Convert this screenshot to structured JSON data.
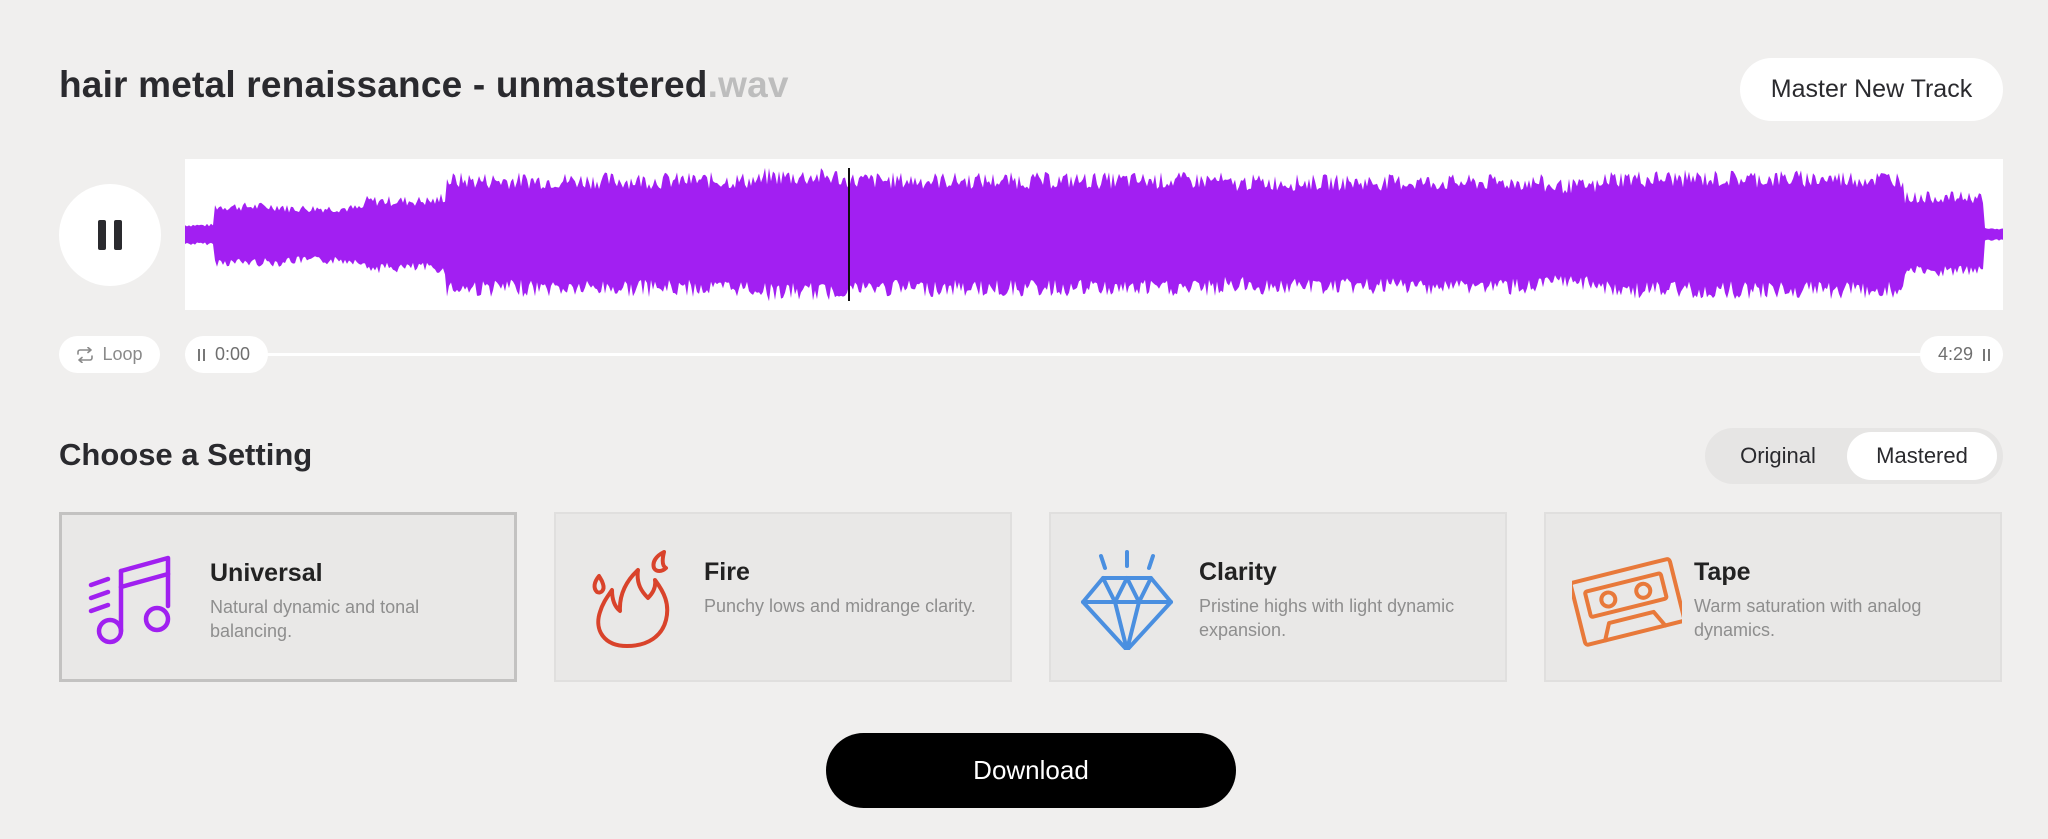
{
  "header": {
    "track_name": "hair metal renaissance - unmastered",
    "track_ext": ".wav",
    "master_button_label": "Master New Track"
  },
  "player": {
    "state": "playing",
    "playhead_fraction": 0.365,
    "waveform_color": "#a21ff2",
    "loop_label": "Loop",
    "current_time": "0:00",
    "total_time": "4:29"
  },
  "settings": {
    "title": "Choose a Setting",
    "toggle": {
      "original_label": "Original",
      "mastered_label": "Mastered",
      "selected": "Mastered"
    },
    "cards": [
      {
        "name": "Universal",
        "description": "Natural dynamic and tonal balancing.",
        "icon": "music-note-icon",
        "color": "#a020f0",
        "selected": true
      },
      {
        "name": "Fire",
        "description": "Punchy lows and midrange clarity.",
        "icon": "flame-icon",
        "color": "#d9432b",
        "selected": false
      },
      {
        "name": "Clarity",
        "description": "Pristine highs with light dynamic expansion.",
        "icon": "diamond-icon",
        "color": "#4a8fe0",
        "selected": false
      },
      {
        "name": "Tape",
        "description": "Warm saturation with analog dynamics.",
        "icon": "cassette-icon",
        "color": "#e8793a",
        "selected": false
      }
    ]
  },
  "download_label": "Download"
}
